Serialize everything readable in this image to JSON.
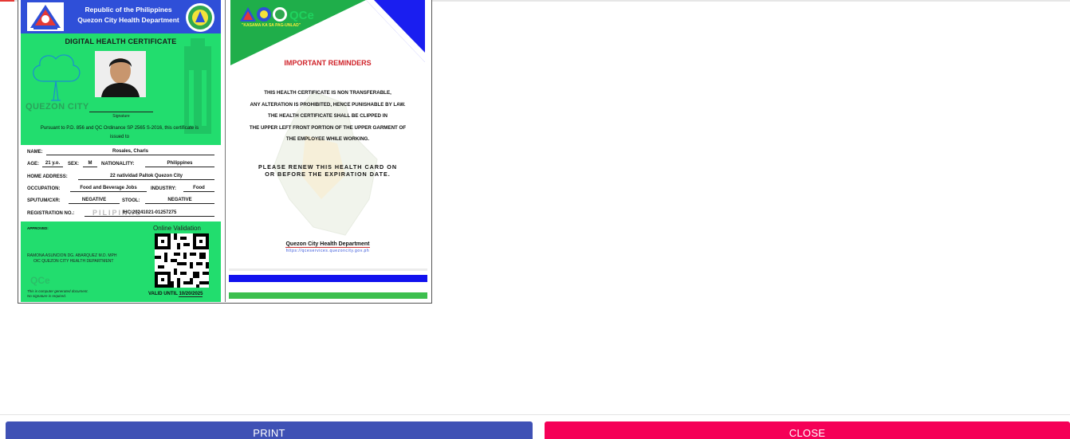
{
  "front": {
    "header_line1": "Republic of the Philippines",
    "header_line2": "Quezon City Health Department",
    "title": "DIGITAL HEALTH CERTIFICATE",
    "brand_word": "QUEZON CITY",
    "signature_label": "Signature",
    "pursuant": "Pursuant to P.D. 856 and QC Ordinance SP 2565 S-2016, this certificate is issued to",
    "fields": {
      "name_label": "NAME:",
      "name": "Rosales, Charls",
      "age_label": "AGE:",
      "age": "21 y.o.",
      "sex_label": "SEX:",
      "sex": "M",
      "nationality_label": "NATIONALITY:",
      "nationality": "Philippines",
      "address_label": "HOME ADDRESS:",
      "address": "22 natividad Paltok Quezon City",
      "occupation_label": "OCCUPATION:",
      "occupation": "Food and Beverage Jobs",
      "industry_label": "INDUSTRY:",
      "industry": "Food",
      "sputum_label": "SPUTUM/CXR:",
      "sputum": "NEGATIVE",
      "stool_label": "STOOL:",
      "stool": "NEGATIVE",
      "reg_label": "REGISTRATION NO.:",
      "reg": "IHC-20241021-01257275"
    },
    "watermark": "PILIPINAS",
    "approved_label": "APPROVED:",
    "approver_name": "RAMONA ASUNCION DG. ABARQUEZ M.D. MPH",
    "approver_title": "OIC QUEZON CITY HEALTH DEPARTMENT",
    "online_validation": "Online Validation",
    "qc_logo_text": "QCe",
    "disclaimer_1": "This is computer generated document.",
    "disclaimer_2": "No signature is required.",
    "valid_label": "VALID UNTIL",
    "valid_date": "10/20/2025"
  },
  "back": {
    "logo_text": "QCe",
    "motto": "\"KASAMA KA SA PAG-UNLAD\"",
    "reminders_title": "IMPORTANT REMINDERS",
    "rules": [
      "THIS HEALTH CERTIFICATE IS NON TRANSFERABLE,",
      "ANY ALTERATION IS PROHIBITED, HENCE PUNISHABLE BY LAW.",
      "THE HEALTH CERTIFICATE SHALL BE CLIPPED IN",
      "THE UPPER LEFT FRONT PORTION OF THE UPPER GARMENT OF",
      "THE EMPLOYEE WHILE WORKING."
    ],
    "renew_1": "PLEASE RENEW THIS HEALTH CARD ON",
    "renew_2": "OR BEFORE THE EXPIRATION DATE.",
    "dept": "Quezon City Health Department",
    "url": "https://qceservices.quezoncity.gov.ph"
  },
  "buttons": {
    "print": "PRINT",
    "close": "CLOSE"
  },
  "colors": {
    "card_green": "#22dd6e",
    "header_blue": "#2f4fd8",
    "print_button": "#3f51b5",
    "close_button": "#f50057",
    "reminder_red": "#d0232a"
  }
}
